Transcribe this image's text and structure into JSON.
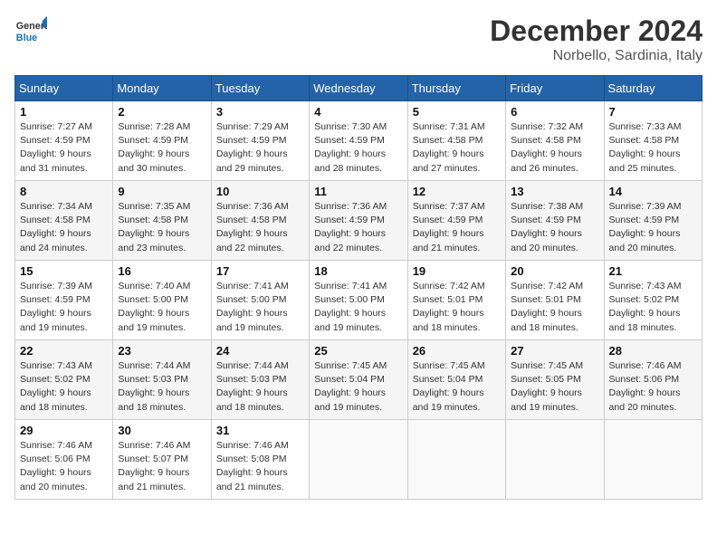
{
  "header": {
    "logo_line1": "General",
    "logo_line2": "Blue",
    "month": "December 2024",
    "location": "Norbello, Sardinia, Italy"
  },
  "weekdays": [
    "Sunday",
    "Monday",
    "Tuesday",
    "Wednesday",
    "Thursday",
    "Friday",
    "Saturday"
  ],
  "weeks": [
    [
      {
        "day": "1",
        "sunrise": "Sunrise: 7:27 AM",
        "sunset": "Sunset: 4:59 PM",
        "daylight": "Daylight: 9 hours and 31 minutes."
      },
      {
        "day": "2",
        "sunrise": "Sunrise: 7:28 AM",
        "sunset": "Sunset: 4:59 PM",
        "daylight": "Daylight: 9 hours and 30 minutes."
      },
      {
        "day": "3",
        "sunrise": "Sunrise: 7:29 AM",
        "sunset": "Sunset: 4:59 PM",
        "daylight": "Daylight: 9 hours and 29 minutes."
      },
      {
        "day": "4",
        "sunrise": "Sunrise: 7:30 AM",
        "sunset": "Sunset: 4:59 PM",
        "daylight": "Daylight: 9 hours and 28 minutes."
      },
      {
        "day": "5",
        "sunrise": "Sunrise: 7:31 AM",
        "sunset": "Sunset: 4:58 PM",
        "daylight": "Daylight: 9 hours and 27 minutes."
      },
      {
        "day": "6",
        "sunrise": "Sunrise: 7:32 AM",
        "sunset": "Sunset: 4:58 PM",
        "daylight": "Daylight: 9 hours and 26 minutes."
      },
      {
        "day": "7",
        "sunrise": "Sunrise: 7:33 AM",
        "sunset": "Sunset: 4:58 PM",
        "daylight": "Daylight: 9 hours and 25 minutes."
      }
    ],
    [
      {
        "day": "8",
        "sunrise": "Sunrise: 7:34 AM",
        "sunset": "Sunset: 4:58 PM",
        "daylight": "Daylight: 9 hours and 24 minutes."
      },
      {
        "day": "9",
        "sunrise": "Sunrise: 7:35 AM",
        "sunset": "Sunset: 4:58 PM",
        "daylight": "Daylight: 9 hours and 23 minutes."
      },
      {
        "day": "10",
        "sunrise": "Sunrise: 7:36 AM",
        "sunset": "Sunset: 4:58 PM",
        "daylight": "Daylight: 9 hours and 22 minutes."
      },
      {
        "day": "11",
        "sunrise": "Sunrise: 7:36 AM",
        "sunset": "Sunset: 4:59 PM",
        "daylight": "Daylight: 9 hours and 22 minutes."
      },
      {
        "day": "12",
        "sunrise": "Sunrise: 7:37 AM",
        "sunset": "Sunset: 4:59 PM",
        "daylight": "Daylight: 9 hours and 21 minutes."
      },
      {
        "day": "13",
        "sunrise": "Sunrise: 7:38 AM",
        "sunset": "Sunset: 4:59 PM",
        "daylight": "Daylight: 9 hours and 20 minutes."
      },
      {
        "day": "14",
        "sunrise": "Sunrise: 7:39 AM",
        "sunset": "Sunset: 4:59 PM",
        "daylight": "Daylight: 9 hours and 20 minutes."
      }
    ],
    [
      {
        "day": "15",
        "sunrise": "Sunrise: 7:39 AM",
        "sunset": "Sunset: 4:59 PM",
        "daylight": "Daylight: 9 hours and 19 minutes."
      },
      {
        "day": "16",
        "sunrise": "Sunrise: 7:40 AM",
        "sunset": "Sunset: 5:00 PM",
        "daylight": "Daylight: 9 hours and 19 minutes."
      },
      {
        "day": "17",
        "sunrise": "Sunrise: 7:41 AM",
        "sunset": "Sunset: 5:00 PM",
        "daylight": "Daylight: 9 hours and 19 minutes."
      },
      {
        "day": "18",
        "sunrise": "Sunrise: 7:41 AM",
        "sunset": "Sunset: 5:00 PM",
        "daylight": "Daylight: 9 hours and 19 minutes."
      },
      {
        "day": "19",
        "sunrise": "Sunrise: 7:42 AM",
        "sunset": "Sunset: 5:01 PM",
        "daylight": "Daylight: 9 hours and 18 minutes."
      },
      {
        "day": "20",
        "sunrise": "Sunrise: 7:42 AM",
        "sunset": "Sunset: 5:01 PM",
        "daylight": "Daylight: 9 hours and 18 minutes."
      },
      {
        "day": "21",
        "sunrise": "Sunrise: 7:43 AM",
        "sunset": "Sunset: 5:02 PM",
        "daylight": "Daylight: 9 hours and 18 minutes."
      }
    ],
    [
      {
        "day": "22",
        "sunrise": "Sunrise: 7:43 AM",
        "sunset": "Sunset: 5:02 PM",
        "daylight": "Daylight: 9 hours and 18 minutes."
      },
      {
        "day": "23",
        "sunrise": "Sunrise: 7:44 AM",
        "sunset": "Sunset: 5:03 PM",
        "daylight": "Daylight: 9 hours and 18 minutes."
      },
      {
        "day": "24",
        "sunrise": "Sunrise: 7:44 AM",
        "sunset": "Sunset: 5:03 PM",
        "daylight": "Daylight: 9 hours and 18 minutes."
      },
      {
        "day": "25",
        "sunrise": "Sunrise: 7:45 AM",
        "sunset": "Sunset: 5:04 PM",
        "daylight": "Daylight: 9 hours and 19 minutes."
      },
      {
        "day": "26",
        "sunrise": "Sunrise: 7:45 AM",
        "sunset": "Sunset: 5:04 PM",
        "daylight": "Daylight: 9 hours and 19 minutes."
      },
      {
        "day": "27",
        "sunrise": "Sunrise: 7:45 AM",
        "sunset": "Sunset: 5:05 PM",
        "daylight": "Daylight: 9 hours and 19 minutes."
      },
      {
        "day": "28",
        "sunrise": "Sunrise: 7:46 AM",
        "sunset": "Sunset: 5:06 PM",
        "daylight": "Daylight: 9 hours and 20 minutes."
      }
    ],
    [
      {
        "day": "29",
        "sunrise": "Sunrise: 7:46 AM",
        "sunset": "Sunset: 5:06 PM",
        "daylight": "Daylight: 9 hours and 20 minutes."
      },
      {
        "day": "30",
        "sunrise": "Sunrise: 7:46 AM",
        "sunset": "Sunset: 5:07 PM",
        "daylight": "Daylight: 9 hours and 21 minutes."
      },
      {
        "day": "31",
        "sunrise": "Sunrise: 7:46 AM",
        "sunset": "Sunset: 5:08 PM",
        "daylight": "Daylight: 9 hours and 21 minutes."
      },
      null,
      null,
      null,
      null
    ]
  ]
}
